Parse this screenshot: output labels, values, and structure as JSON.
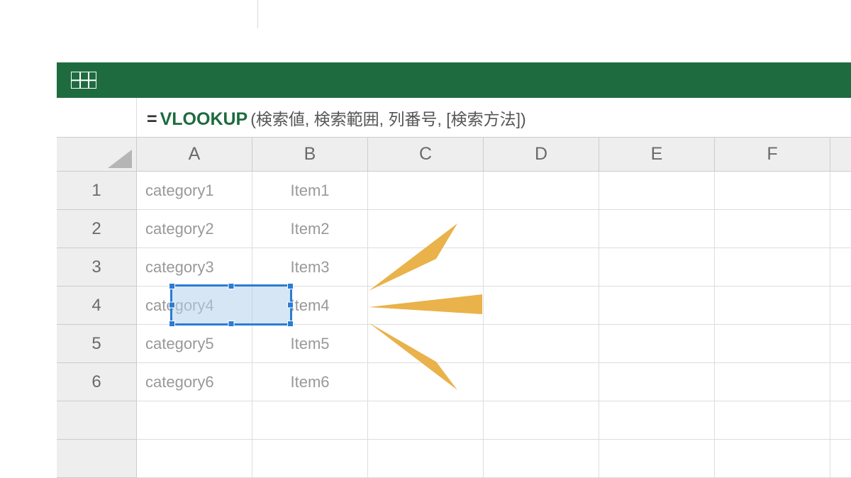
{
  "colors": {
    "ribbon": "#1e6b3f",
    "accent": "#e9b24a",
    "selection": "#2b7cd3"
  },
  "formula": {
    "equals": "=",
    "name": "VLOOKUP",
    "params": "(検索値, 検索範囲, 列番号, [検索方法])"
  },
  "columns": [
    "A",
    "B",
    "C",
    "D",
    "E",
    "F"
  ],
  "rows": [
    "1",
    "2",
    "3",
    "4",
    "5",
    "6"
  ],
  "grid": {
    "a": [
      "category1",
      "category2",
      "category3",
      "category4",
      "category5",
      "category6"
    ],
    "b": [
      "Item1",
      "Item2",
      "Item3",
      "Item4",
      "Item5",
      "Item6"
    ]
  },
  "selected_cell": {
    "row": 4,
    "col": "B",
    "value": "Item4"
  }
}
